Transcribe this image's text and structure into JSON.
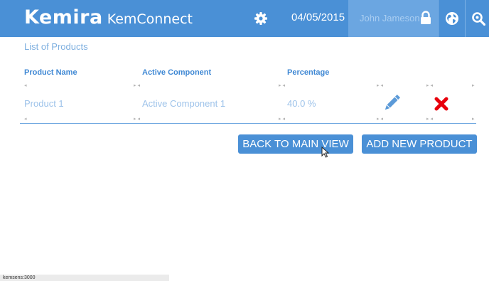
{
  "header": {
    "brand_logo": "Kemira",
    "app_name": "KemConnect",
    "date": "04/05/2015",
    "user_name": "John Jameson",
    "icons": {
      "settings": "gear-icon",
      "lock": "lock-icon",
      "language": "globe-icon",
      "search": "search-icon"
    }
  },
  "page": {
    "title": "List of Products"
  },
  "table": {
    "columns": [
      "Product Name",
      "Active Component",
      "Percentage"
    ],
    "rows": [
      {
        "product_name": "Product 1",
        "active_component": "Active Component 1",
        "percentage": "40.0 %"
      }
    ],
    "edit_icon": "pencil-icon",
    "delete_icon": "x-icon"
  },
  "actions": {
    "back_label": "BACK TO MAIN VIEW",
    "add_label": "ADD NEW PRODUCT"
  },
  "status_bar": {
    "text": "kemsens:3000"
  },
  "colors": {
    "primary": "#4a90d6",
    "user_area": "#6ba6e1",
    "delete": "#e8000b",
    "muted_text": "#9ec3ea"
  }
}
